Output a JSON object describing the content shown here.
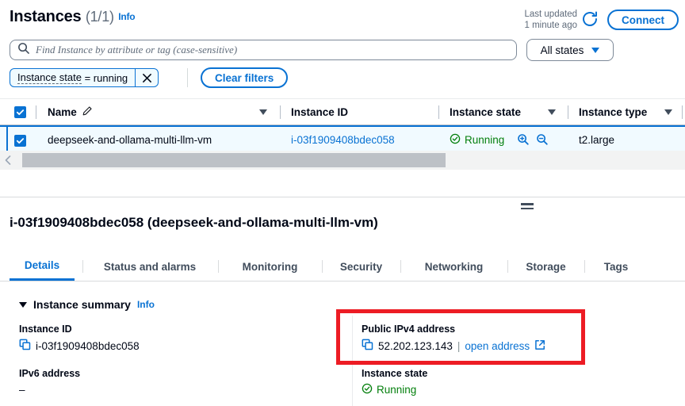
{
  "header": {
    "title": "Instances",
    "count": "(1/1)",
    "info_label": "Info",
    "last_updated_line1": "Last updated",
    "last_updated_line2": "1 minute ago",
    "refresh_icon": "refresh-icon",
    "connect_label": "Connect"
  },
  "search": {
    "placeholder": "Find Instance by attribute or tag (case-sensitive)",
    "icon": "search-icon",
    "states_dropdown": "All states"
  },
  "filters": {
    "token_property": "Instance state",
    "token_operator": "=",
    "token_value": "running",
    "token_remove_icon": "close-icon",
    "clear_label": "Clear filters"
  },
  "table": {
    "columns": [
      {
        "label": "Name",
        "icon": "pencil-icon",
        "sortable": true
      },
      {
        "label": "Instance ID",
        "sortable": false
      },
      {
        "label": "Instance state",
        "sortable": true
      },
      {
        "label": "Instance type",
        "sortable": true
      }
    ],
    "rows": [
      {
        "selected": true,
        "name": "deepseek-and-ollama-multi-llm-vm",
        "instance_id": "i-03f1909408bdec058",
        "instance_state": "Running",
        "state_icon": "check-circle-icon",
        "zoom_in_icon": "magnifier-plus-icon",
        "zoom_out_icon": "magnifier-minus-icon",
        "instance_type": "t2.large"
      }
    ]
  },
  "detail": {
    "title": "i-03f1909408bdec058 (deepseek-and-ollama-multi-llm-vm)",
    "tabs": [
      {
        "label": "Details",
        "active": true
      },
      {
        "label": "Status and alarms",
        "active": false
      },
      {
        "label": "Monitoring",
        "active": false
      },
      {
        "label": "Security",
        "active": false
      },
      {
        "label": "Networking",
        "active": false
      },
      {
        "label": "Storage",
        "active": false
      },
      {
        "label": "Tags",
        "active": false
      }
    ],
    "summary_title": "Instance summary",
    "summary_info": "Info",
    "fields": {
      "instance_id_label": "Instance ID",
      "instance_id_value": "i-03f1909408bdec058",
      "ipv6_label": "IPv6 address",
      "ipv6_value": "–",
      "public_ipv4_label": "Public IPv4 address",
      "public_ipv4_value": "52.202.123.143",
      "public_ipv4_divider": "|",
      "open_address_label": "open address",
      "open_address_icon": "external-link-icon",
      "instance_state_label": "Instance state",
      "instance_state_value": "Running",
      "copy_icon": "copy-icon"
    }
  },
  "colors": {
    "accent": "#0972d3",
    "success": "#037f0c",
    "annotation": "#ed1c24",
    "selected_row_bg": "#f1faff"
  }
}
